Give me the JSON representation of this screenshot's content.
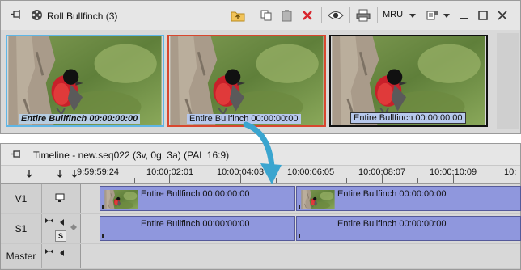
{
  "bin": {
    "title": "Roll  Bullfinch (3)",
    "mru_label": "MRU",
    "toolbar_icons": [
      "folder-up-icon",
      "copy-icon",
      "paste-icon",
      "delete-icon",
      "eye-icon",
      "print-icon",
      "mru-dropdown",
      "view-options-icon",
      "minimize-icon",
      "maximize-icon",
      "close-icon"
    ],
    "clips": [
      {
        "caption": "Entire Bullfinch 00:00:00:00",
        "state": "selected"
      },
      {
        "caption": "Entire Bullfinch 00:00:00:00",
        "state": "active"
      },
      {
        "caption": "Entire Bullfinch 00:00:00:00",
        "state": "normal"
      }
    ]
  },
  "timeline": {
    "title": "Timeline - new.seq022 (3v, 0g, 3a) (PAL 16:9)",
    "ruler_labels": [
      "9:59:59:24",
      "10:00:02:01",
      "10:00:04:03",
      "10:00:06:05",
      "10:00:08:07",
      "10:00:10:09",
      "10:"
    ],
    "tracks": [
      {
        "name": "V1",
        "clips": [
          "Entire Bullfinch 00:00:00:00",
          "Entire Bullfinch 00:00:00:00"
        ]
      },
      {
        "name": "S1",
        "solo_label": "S",
        "clips": [
          "Entire Bullfinch 00:00:00:00",
          "Entire Bullfinch 00:00:00:00"
        ]
      },
      {
        "name": "Master"
      }
    ]
  },
  "colors": {
    "selected_border": "#5fb6e6",
    "active_border": "#d8472f",
    "clip_fill": "#8f97dd",
    "delete_red": "#d8262e",
    "drag_arrow": "#3aa5cf"
  }
}
